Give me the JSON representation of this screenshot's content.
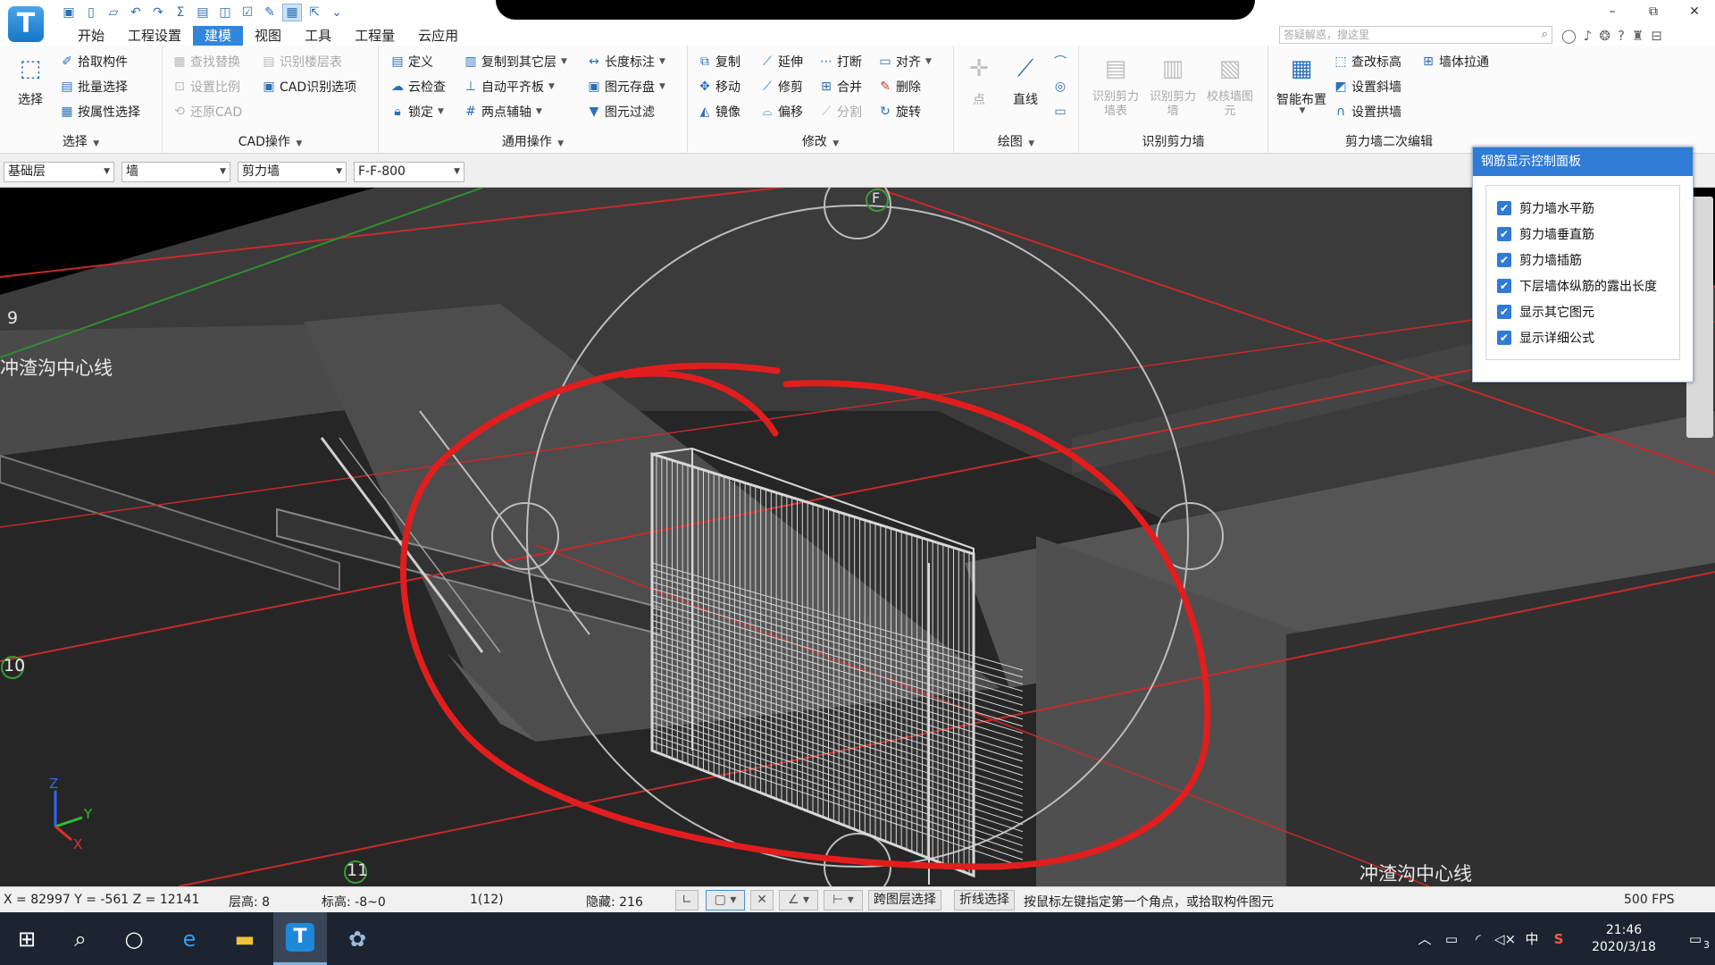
{
  "window": {
    "logo_letter": "T",
    "controls": [
      "–",
      "⧉",
      "✕"
    ]
  },
  "menu": {
    "tabs": [
      "开始",
      "工程设置",
      "建模",
      "视图",
      "工具",
      "工程量",
      "云应用"
    ],
    "active_tab": "建模",
    "search_placeholder": "答疑解惑，搜这里"
  },
  "ribbon": {
    "select_group": {
      "label": "选择",
      "big_button": "选择",
      "items": [
        "拾取构件",
        "批量选择",
        "按属性选择"
      ]
    },
    "cad_group": {
      "label": "CAD操作",
      "items": [
        "查找替换",
        "识别楼层表",
        "设置比例",
        "CAD识别选项",
        "还原CAD"
      ]
    },
    "general_group": {
      "label": "通用操作",
      "items": [
        "定义",
        "复制到其它层",
        "长度标注",
        "云检查",
        "自动平齐板",
        "图元存盘",
        "锁定",
        "两点辅轴",
        "图元过滤"
      ]
    },
    "modify_group": {
      "label": "修改",
      "items": [
        "复制",
        "延伸",
        "打断",
        "对齐",
        "移动",
        "修剪",
        "合并",
        "删除",
        "镜像",
        "偏移",
        "分割",
        "旋转"
      ]
    },
    "draw_group": {
      "label": "绘图",
      "items": [
        "点",
        "直线"
      ]
    },
    "recognize_group": {
      "label": "识别剪力墙",
      "items": [
        "识别剪力墙表",
        "识别剪力墙",
        "校核墙图元"
      ]
    },
    "edit_group": {
      "label": "剪力墙二次编辑",
      "items": [
        "智能布置",
        "查改标高",
        "墙体拉通",
        "设置斜墙",
        "设置拱墙"
      ]
    }
  },
  "selectors": {
    "floor": "基础层",
    "category": "墙",
    "type": "剪力墙",
    "component": "F-F-800"
  },
  "viewport": {
    "labels": {
      "centerline_left": "冲渣沟中心线",
      "centerline_right": "冲渣沟中心线",
      "axis_9": "9",
      "axis_10": "10",
      "axis_11": "11",
      "axis_F": "F"
    },
    "gizmo": {
      "z": "Z",
      "y": "Y",
      "x": "X"
    }
  },
  "rebar_panel": {
    "title": "钢筋显示控制面板",
    "options": [
      {
        "label": "剪力墙水平筋",
        "checked": true
      },
      {
        "label": "剪力墙垂直筋",
        "checked": true
      },
      {
        "label": "剪力墙插筋",
        "checked": true
      },
      {
        "label": "下层墙体纵筋的露出长度",
        "checked": true
      },
      {
        "label": "显示其它图元",
        "checked": true
      },
      {
        "label": "显示详细公式",
        "checked": true
      }
    ]
  },
  "status": {
    "coords": "X = 82997 Y = -561 Z = 12141",
    "floor_height": "层高:  8",
    "elevation": "标高: -8~0",
    "page": "1(12)",
    "hidden": "隐藏:  216",
    "cross_layer": "跨图层选择",
    "polyline": "折线选择",
    "hint": "按鼠标左键指定第一个角点，或拾取构件图元",
    "fps": "500 FPS"
  },
  "taskbar": {
    "time": "21:46",
    "date": "2020/3/18",
    "ime": "中",
    "notifications": "3"
  }
}
